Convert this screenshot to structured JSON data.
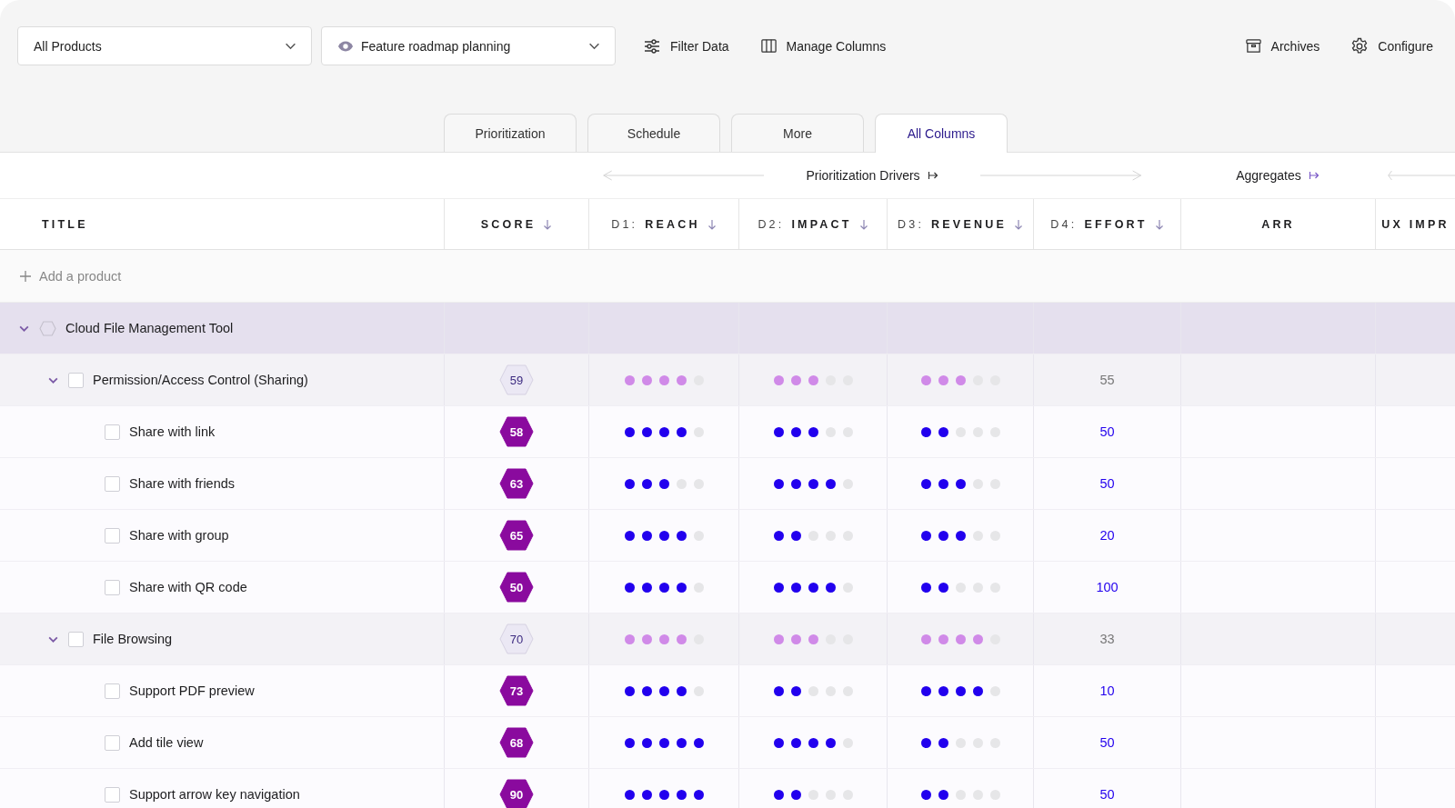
{
  "toolbar": {
    "dropdowns": [
      {
        "value": "All Products"
      },
      {
        "value": "Feature roadmap planning"
      }
    ],
    "actions": [
      {
        "label": "Filter Data"
      },
      {
        "label": "Manage Columns"
      }
    ],
    "right_actions": [
      {
        "label": "Archives"
      },
      {
        "label": "Configure"
      }
    ]
  },
  "tabs": [
    {
      "label": "Prioritization",
      "selected": false
    },
    {
      "label": "Schedule",
      "selected": false
    },
    {
      "label": "More",
      "selected": false
    },
    {
      "label": "All Columns",
      "selected": true
    }
  ],
  "column_groups": [
    {
      "label": "Prioritization Drivers",
      "kind": "drivers"
    },
    {
      "label": "Aggregates",
      "kind": "aggregates"
    }
  ],
  "columns": [
    {
      "label": "TITLE",
      "sorted": false
    },
    {
      "label": "SCORE",
      "sorted": true
    },
    {
      "prefix": "D1:",
      "label": "REACH",
      "sorted": true
    },
    {
      "prefix": "D2:",
      "label": "IMPACT",
      "sorted": true
    },
    {
      "prefix": "D3:",
      "label": "REVENUE",
      "sorted": true
    },
    {
      "prefix": "D4:",
      "label": "EFFORT",
      "sorted": true
    },
    {
      "label": "ARR",
      "sorted": false
    },
    {
      "label": "UX IMPR",
      "sorted": false
    }
  ],
  "add_row": {
    "label": "Add a product"
  },
  "rows": [
    {
      "title": "Cloud File Management Tool",
      "expanded": true,
      "children": [
        {
          "title": "Permission/Access Control (Sharing)",
          "expanded": true,
          "checked": false,
          "score": "59",
          "drivers": [
            {
              "stars": 4
            },
            {
              "stars": 3
            },
            {
              "stars": 3
            }
          ],
          "effort": "55",
          "children": [
            {
              "title": "Share with link",
              "checked": false,
              "score": "58",
              "drivers": [
                {
                  "stars": 4
                },
                {
                  "stars": 3
                },
                {
                  "stars": 2
                }
              ],
              "effort": "50"
            },
            {
              "title": "Share with friends",
              "checked": false,
              "score": "63",
              "drivers": [
                {
                  "stars": 3
                },
                {
                  "stars": 4
                },
                {
                  "stars": 3
                }
              ],
              "effort": "50"
            },
            {
              "title": "Share with group",
              "checked": false,
              "score": "65",
              "drivers": [
                {
                  "stars": 4
                },
                {
                  "stars": 2
                },
                {
                  "stars": 3
                }
              ],
              "effort": "20"
            },
            {
              "title": "Share with QR code",
              "checked": false,
              "score": "50",
              "drivers": [
                {
                  "stars": 4
                },
                {
                  "stars": 4
                },
                {
                  "stars": 2
                }
              ],
              "effort": "100"
            }
          ]
        },
        {
          "title": "File Browsing",
          "expanded": true,
          "checked": false,
          "score": "70",
          "drivers": [
            {
              "stars": 4
            },
            {
              "stars": 3
            },
            {
              "stars": 4
            }
          ],
          "effort": "33",
          "children": [
            {
              "title": "Support PDF preview",
              "checked": false,
              "score": "73",
              "drivers": [
                {
                  "stars": 4
                },
                {
                  "stars": 2
                },
                {
                  "stars": 4
                }
              ],
              "effort": "10"
            },
            {
              "title": "Add tile view",
              "checked": false,
              "score": "68",
              "drivers": [
                {
                  "stars": 5
                },
                {
                  "stars": 4
                },
                {
                  "stars": 2
                }
              ],
              "effort": "50"
            },
            {
              "title": "Support arrow key navigation",
              "checked": false,
              "score": "90",
              "drivers": [
                {
                  "stars": 5
                },
                {
                  "stars": 2
                },
                {
                  "stars": 2
                }
              ],
              "effort": "50"
            }
          ]
        }
      ]
    }
  ]
}
